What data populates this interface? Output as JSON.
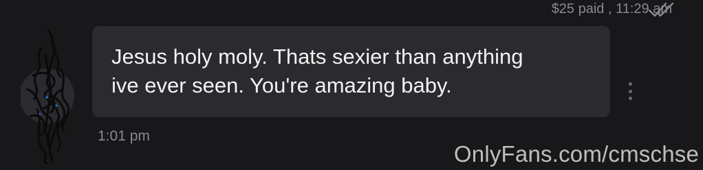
{
  "previous_message": {
    "paid_status": "$25 paid , 11:29 am",
    "read_receipt_icon": "double-check-icon"
  },
  "message": {
    "text": "Jesus holy moly. Thats sexier than anything\nive ever seen. You're amazing baby.",
    "time": "1:01 pm",
    "more_icon": "vertical-dots-icon"
  },
  "avatar": {
    "state": "scribbled-out"
  },
  "watermark": {
    "text": "OnlyFans.com/cmschse"
  },
  "colors": {
    "background": "#18181a",
    "bubble": "#2b2b2f",
    "muted_text": "#8a8a8e",
    "message_text": "#f2f2f2"
  }
}
